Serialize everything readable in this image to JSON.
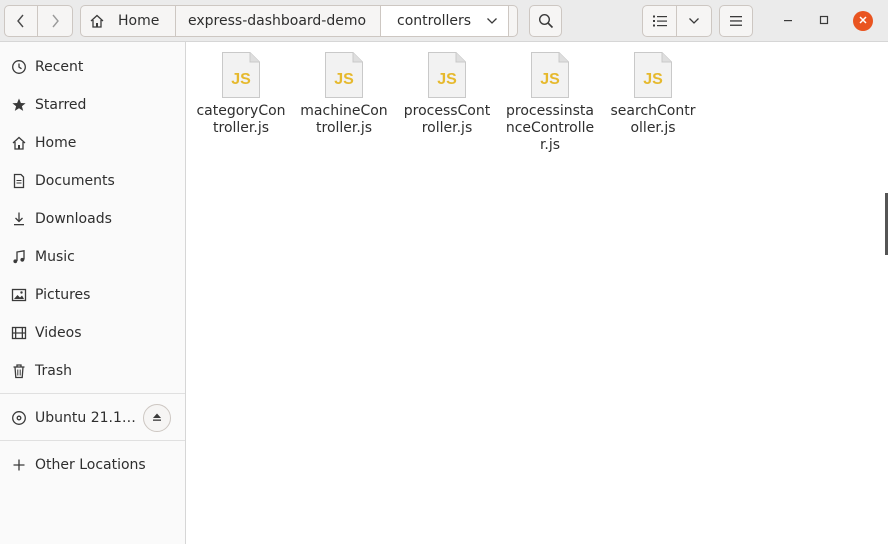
{
  "headerbar": {
    "back_icon": "chevron-left-icon",
    "forward_icon": "chevron-right-icon",
    "path": [
      {
        "label": "Home",
        "icon": "home-icon"
      },
      {
        "label": "express-dashboard-demo"
      },
      {
        "label": "controllers",
        "icon": "chevron-down-icon"
      }
    ],
    "search_icon": "search-icon",
    "view_icon": "list-view-icon",
    "view_options_icon": "chevron-down-icon",
    "menu_icon": "hamburger-menu-icon",
    "window_controls": [
      "minimize-icon",
      "maximize-icon",
      "close-icon"
    ],
    "close_color": "#e95420"
  },
  "sidebar": {
    "items": [
      {
        "label": "Recent",
        "icon": "clock-icon"
      },
      {
        "label": "Starred",
        "icon": "star-icon"
      },
      {
        "label": "Home",
        "icon": "home-icon"
      },
      {
        "label": "Documents",
        "icon": "document-icon"
      },
      {
        "label": "Downloads",
        "icon": "download-icon"
      },
      {
        "label": "Music",
        "icon": "music-icon"
      },
      {
        "label": "Pictures",
        "icon": "picture-icon"
      },
      {
        "label": "Videos",
        "icon": "video-icon"
      },
      {
        "label": "Trash",
        "icon": "trash-icon"
      }
    ],
    "devices": [
      {
        "label": "Ubuntu 21.1…",
        "icon": "disc-icon",
        "action_icon": "eject-icon"
      }
    ],
    "other": {
      "label": "Other Locations",
      "icon": "plus-icon"
    }
  },
  "files": [
    {
      "name": "categoryController.js",
      "badge": "JS"
    },
    {
      "name": "machineController.js",
      "badge": "JS"
    },
    {
      "name": "processController.js",
      "badge": "JS"
    },
    {
      "name": "processinstanceController.js",
      "badge": "JS"
    },
    {
      "name": "searchController.js",
      "badge": "JS"
    }
  ],
  "colors": {
    "js_badge": "#e6b92e",
    "accent": "#e95420"
  }
}
